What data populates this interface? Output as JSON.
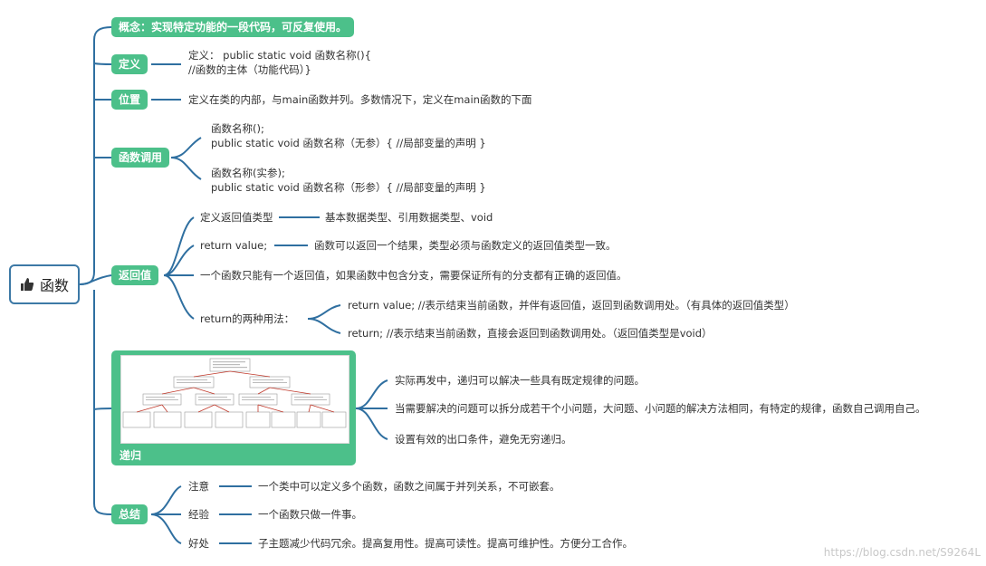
{
  "root": {
    "label": "函数",
    "icon": "thumbs-up-icon"
  },
  "concept": "概念：实现特定功能的一段代码，可反复使用。",
  "definition": {
    "label": "定义",
    "line1": "定义：  public static void 函数名称(){",
    "line2": "//函数的主体（功能代码）}"
  },
  "position": {
    "label": "位置",
    "text": "定义在类的内部，与main函数并列。多数情况下，定义在main函数的下面"
  },
  "call": {
    "label": "函数调用",
    "item1_line1": "函数名称();",
    "item1_line2": "public static void 函数名称（无参）{ //局部变量的声明 }",
    "item2_line1": "函数名称(实参);",
    "item2_line2": "public static void 函数名称（形参）{ //局部变量的声明 }"
  },
  "return_value": {
    "label": "返回值",
    "type_label": "定义返回值类型",
    "type_text": "基本数据类型、引用数据类型、void",
    "stmt_label": "return value;",
    "stmt_text": "函数可以返回一个结果，类型必须与函数定义的返回值类型一致。",
    "single": "一个函数只能有一个返回值，如果函数中包含分支，需要保证所有的分支都有正确的返回值。",
    "usage_label": "return的两种用法：",
    "usage1": "return value; //表示结束当前函数，并伴有返回值，返回到函数调用处。（有具体的返回值类型）",
    "usage2": "return; //表示结束当前函数，直接会返回到函数调用处。（返回值类型是void）"
  },
  "recursion": {
    "label": "递归",
    "point1": "实际再发中，递归可以解决一些具有既定规律的问题。",
    "point2": "当需要解决的问题可以拆分成若干个小问题，大问题、小问题的解决方法相同，有特定的规律，函数自己调用自己。",
    "point3": "设置有效的出口条件，避免无穷递归。"
  },
  "summary": {
    "label": "总结",
    "note_label": "注意",
    "note_text": "一个类中可以定义多个函数，函数之间属于并列关系，不可嵌套。",
    "exp_label": "经验",
    "exp_text": "一个函数只做一件事。",
    "benefit_label": "好处",
    "benefit_text": "子主题减少代码冗余。提高复用性。提高可读性。提高可维护性。方便分工合作。"
  },
  "watermark": "https://blog.csdn.net/S9264L",
  "colors": {
    "branch": "#4cc08a",
    "line": "#2f6fa0",
    "root_border": "#3d79a6"
  }
}
